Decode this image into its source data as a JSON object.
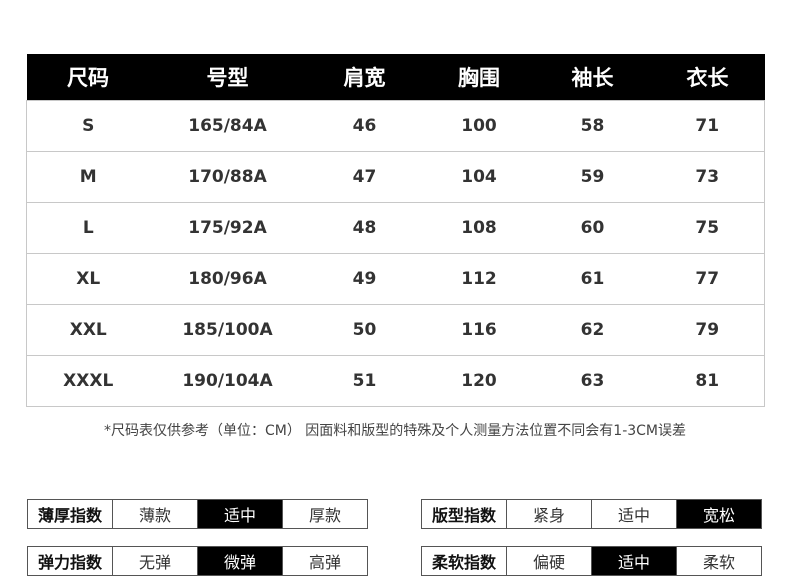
{
  "table": {
    "headers": [
      "尺码",
      "号型",
      "肩宽",
      "胸围",
      "袖长",
      "衣长"
    ],
    "rows": [
      [
        "S",
        "165/84A",
        "46",
        "100",
        "58",
        "71"
      ],
      [
        "M",
        "170/88A",
        "47",
        "104",
        "59",
        "73"
      ],
      [
        "L",
        "175/92A",
        "48",
        "108",
        "60",
        "75"
      ],
      [
        "XL",
        "180/96A",
        "49",
        "112",
        "61",
        "77"
      ],
      [
        "XXL",
        "185/100A",
        "50",
        "116",
        "62",
        "79"
      ],
      [
        "XXXL",
        "190/104A",
        "51",
        "120",
        "63",
        "81"
      ]
    ]
  },
  "note": "*尺码表仅供参考（单位：CM） 因面料和版型的特殊及个人测量方法位置不同会有1-3CM误差",
  "indices": {
    "thickness": {
      "label": "薄厚指数",
      "options": [
        "薄款",
        "适中",
        "厚款"
      ],
      "selected": 1
    },
    "fit": {
      "label": "版型指数",
      "options": [
        "紧身",
        "适中",
        "宽松"
      ],
      "selected": 2
    },
    "elastic": {
      "label": "弹力指数",
      "options": [
        "无弹",
        "微弹",
        "高弹"
      ],
      "selected": 1
    },
    "softness": {
      "label": "柔软指数",
      "options": [
        "偏硬",
        "适中",
        "柔软"
      ],
      "selected": 1
    }
  }
}
